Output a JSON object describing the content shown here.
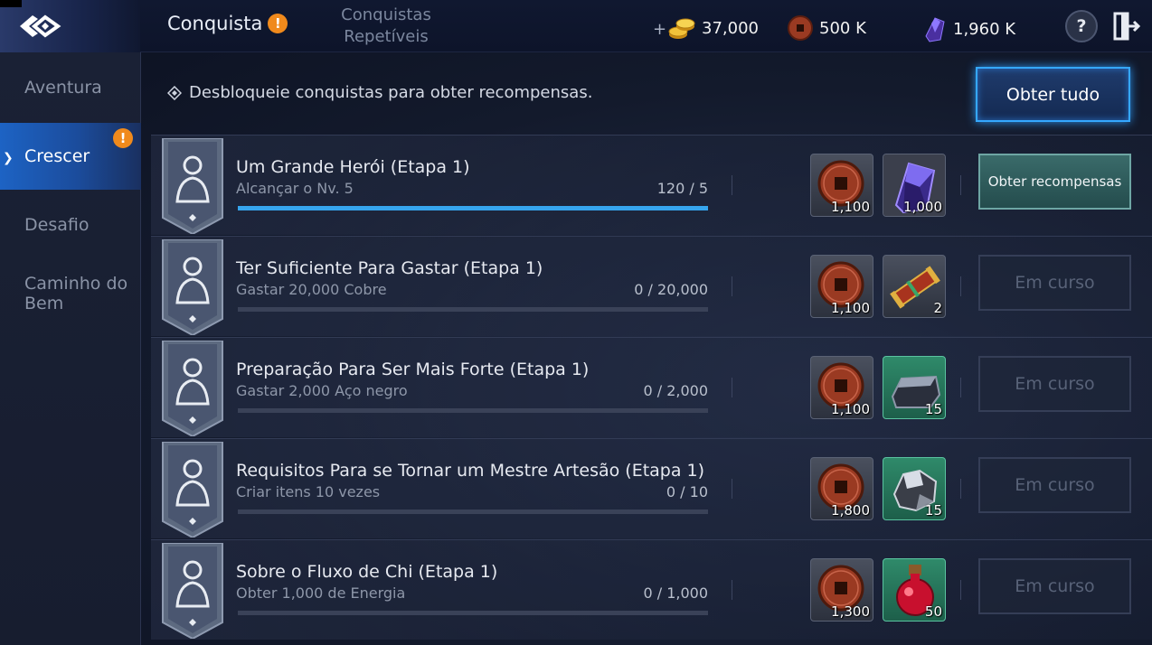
{
  "header": {
    "tab_active": "Conquista",
    "tab_active_alert": "!",
    "tab_other_line1": "Conquistas",
    "tab_other_line2": "Repetíveis",
    "gold_plus": "+",
    "gold": "37,000",
    "copper": "500 K",
    "crystal": "1,960 K",
    "help": "?"
  },
  "sidebar": {
    "items": [
      {
        "label": "Aventura"
      },
      {
        "label": "Crescer"
      },
      {
        "label": "Desafio"
      },
      {
        "label": "Caminho do Bem"
      }
    ],
    "active_index": 1,
    "alert": "!"
  },
  "main": {
    "hint": "Desbloqueie conquistas para obter recompensas.",
    "get_all": "Obter tudo",
    "rows": [
      {
        "title": "Um Grande Herói (Etapa 1)",
        "subtitle": "Alcançar o Nv. 5",
        "progress_text": "120 / 5",
        "progress": 1.0,
        "reward1_qty": "1,100",
        "reward2_qty": "1,000",
        "reward2_icon": "purple-crystal-icon",
        "button": "Obter recompensas",
        "button_state": "claimable"
      },
      {
        "title": "Ter Suficiente Para Gastar (Etapa 1)",
        "subtitle": "Gastar 20,000 Cobre",
        "progress_text": "0 / 20,000",
        "progress": 0,
        "reward1_qty": "1,100",
        "reward2_qty": "2",
        "reward2_icon": "scroll-icon",
        "button": "Em curso",
        "button_state": "in-progress"
      },
      {
        "title": "Preparação Para Ser Mais Forte (Etapa 1)",
        "subtitle": "Gastar 2,000 Aço negro",
        "progress_text": "0 / 2,000",
        "progress": 0,
        "reward1_qty": "1,100",
        "reward2_qty": "15",
        "reward2_icon": "ingot-icon",
        "button": "Em curso",
        "button_state": "in-progress"
      },
      {
        "title": "Requisitos Para se Tornar um Mestre Artesão (Etapa 1)",
        "subtitle": "Criar itens 10 vezes",
        "progress_text": "0 / 10",
        "progress": 0,
        "reward1_qty": "1,800",
        "reward2_qty": "15",
        "reward2_icon": "ore-icon",
        "button": "Em curso",
        "button_state": "in-progress"
      },
      {
        "title": "Sobre o Fluxo de Chi (Etapa 1)",
        "subtitle": "Obter 1,000 de Energia",
        "progress_text": "0 / 1,000",
        "progress": 0,
        "reward1_qty": "1,300",
        "reward2_qty": "50",
        "reward2_icon": "red-potion-icon",
        "button": "Em curso",
        "button_state": "in-progress"
      }
    ]
  },
  "colors": {
    "accent": "#36a5ee",
    "alert": "#f08a1c",
    "claim": "#3a6b6a"
  }
}
